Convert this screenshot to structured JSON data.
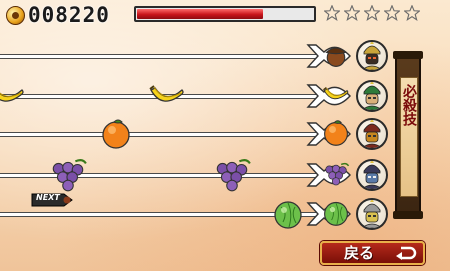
{
  "hud": {
    "score": "008220",
    "health_fraction": 0.71,
    "stars_total": 5,
    "stars_earned": 0
  },
  "lanes": [
    {
      "target": "acorn",
      "notes": []
    },
    {
      "target": "banana",
      "notes": [
        "banana",
        "banana"
      ]
    },
    {
      "target": "orange",
      "notes": [
        "orange"
      ]
    },
    {
      "target": "grapes",
      "notes": [
        "grapes",
        "grapes"
      ]
    },
    {
      "target": "melon",
      "notes": [
        "melon"
      ]
    }
  ],
  "special_banner": {
    "label": "必殺技"
  },
  "next_tag": {
    "label": "NEXT"
  },
  "back_button": {
    "label": "戻る"
  }
}
